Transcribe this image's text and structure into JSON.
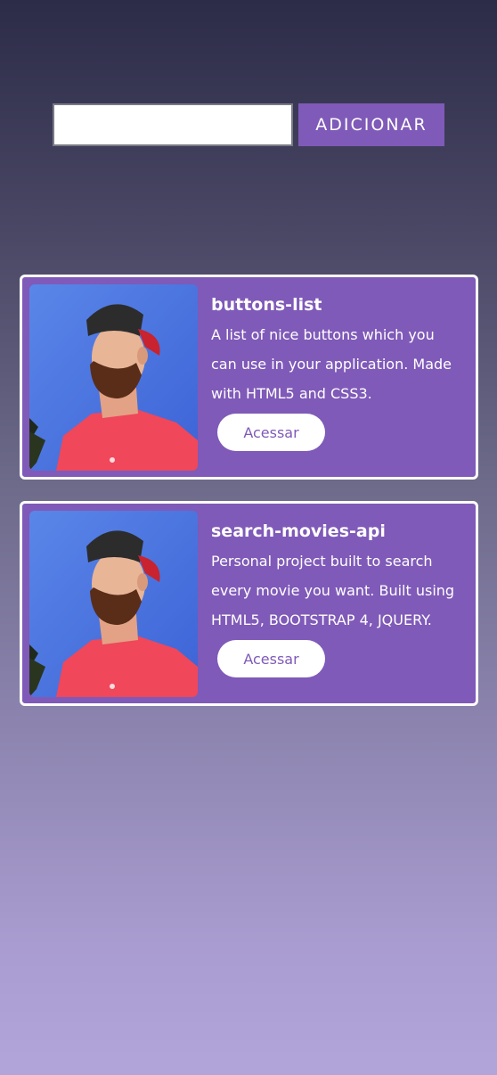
{
  "form": {
    "input_value": "",
    "input_placeholder": "",
    "add_button_label": "ADICIONAR"
  },
  "projects": [
    {
      "title": "buttons-list",
      "description": "A list of nice buttons which you can use in your application. Made with HTML5 and CSS3.",
      "button_label": "Acessar"
    },
    {
      "title": "search-movies-api",
      "description": "Personal project built to search every movie you want. Built using HTML5, BOOTSTRAP 4, JQUERY.",
      "button_label": "Acessar"
    }
  ],
  "colors": {
    "accent": "#7f5ab8",
    "card_border": "#ffffff",
    "background_top": "#2c2b48",
    "background_bottom": "#b1a5d9"
  }
}
